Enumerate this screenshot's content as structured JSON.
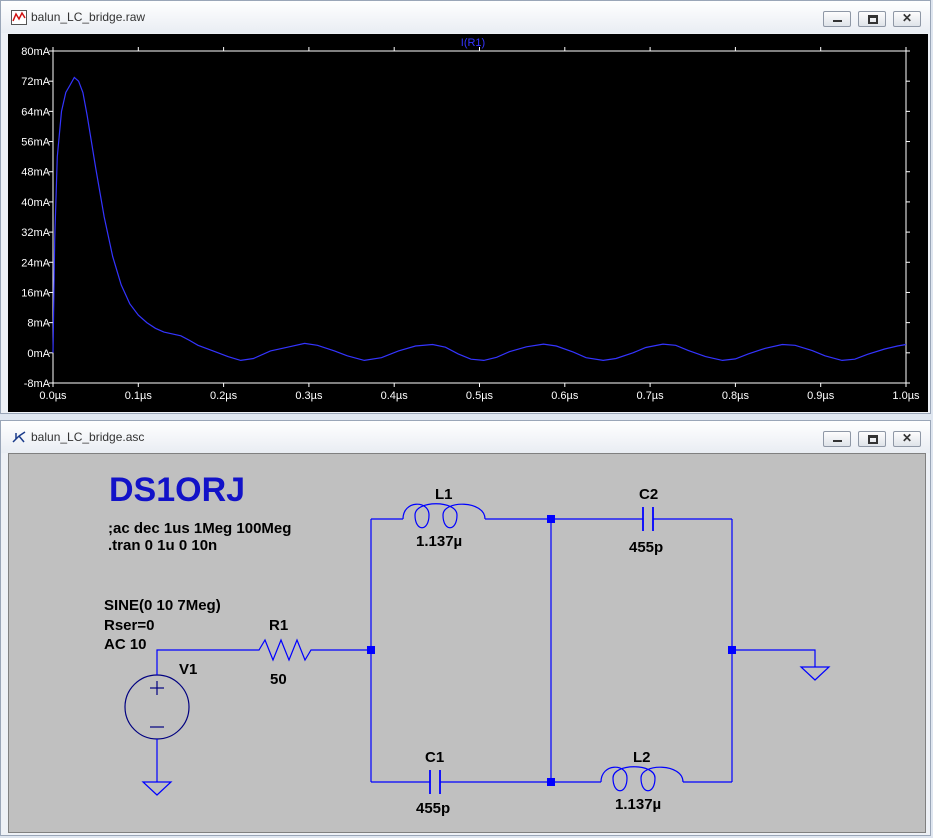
{
  "plot_window": {
    "title": "balun_LC_bridge.raw",
    "trace_label": "I(R1)"
  },
  "schematic_window": {
    "title": "balun_LC_bridge.asc",
    "heading": "DS1ORJ",
    "directive_ac": ";ac dec 1us 1Meg 100Meg",
    "directive_tran": ".tran 0 1u 0 10n",
    "source_params": [
      "SINE(0 10 7Meg)",
      "Rser=0",
      "AC 10"
    ],
    "components": {
      "v1": "V1",
      "r1": {
        "ref": "R1",
        "value": "50"
      },
      "l1": {
        "ref": "L1",
        "value": "1.137µ"
      },
      "c2": {
        "ref": "C2",
        "value": "455p"
      },
      "c1": {
        "ref": "C1",
        "value": "455p"
      },
      "l2": {
        "ref": "L2",
        "value": "1.137µ"
      }
    }
  },
  "window_controls": {
    "minimize": "–",
    "maximize": "□",
    "close": "✕"
  },
  "colors": {
    "trace": "#3434ff",
    "plot_bg": "#000000",
    "schematic_bg": "#c0c0c0",
    "wire": "#0000ff",
    "heading": "#1212c8"
  },
  "chart_data": {
    "type": "line",
    "title": "I(R1)",
    "xlabel": "",
    "ylabel": "",
    "xlim": [
      0,
      1.0
    ],
    "ylim": [
      -8,
      80
    ],
    "x_ticks": [
      "0.0µs",
      "0.1µs",
      "0.2µs",
      "0.3µs",
      "0.4µs",
      "0.5µs",
      "0.6µs",
      "0.7µs",
      "0.8µs",
      "0.9µs",
      "1.0µs"
    ],
    "y_ticks": [
      "80mA",
      "72mA",
      "64mA",
      "56mA",
      "48mA",
      "40mA",
      "32mA",
      "24mA",
      "16mA",
      "8mA",
      "0mA",
      "-8mA"
    ],
    "series": [
      {
        "name": "I(R1)",
        "x_unit": "µs",
        "y_unit": "mA",
        "points": [
          [
            0.0,
            0
          ],
          [
            0.002,
            30
          ],
          [
            0.005,
            52
          ],
          [
            0.01,
            64
          ],
          [
            0.015,
            69
          ],
          [
            0.02,
            71
          ],
          [
            0.025,
            73
          ],
          [
            0.03,
            72
          ],
          [
            0.035,
            69
          ],
          [
            0.04,
            63
          ],
          [
            0.05,
            49
          ],
          [
            0.06,
            36
          ],
          [
            0.07,
            25.5
          ],
          [
            0.08,
            18
          ],
          [
            0.09,
            13
          ],
          [
            0.1,
            10
          ],
          [
            0.11,
            8
          ],
          [
            0.12,
            6.5
          ],
          [
            0.13,
            5.5
          ],
          [
            0.15,
            4.5
          ],
          [
            0.16,
            3.3
          ],
          [
            0.17,
            2
          ],
          [
            0.19,
            0.3
          ],
          [
            0.205,
            -1
          ],
          [
            0.22,
            -2
          ],
          [
            0.235,
            -1.5
          ],
          [
            0.255,
            0.5
          ],
          [
            0.275,
            1.5
          ],
          [
            0.295,
            2.5
          ],
          [
            0.31,
            2
          ],
          [
            0.33,
            0.5
          ],
          [
            0.345,
            -0.8
          ],
          [
            0.365,
            -2
          ],
          [
            0.385,
            -1.3
          ],
          [
            0.405,
            0.5
          ],
          [
            0.425,
            1.8
          ],
          [
            0.445,
            2.2
          ],
          [
            0.46,
            1.5
          ],
          [
            0.475,
            -0.3
          ],
          [
            0.49,
            -1.7
          ],
          [
            0.505,
            -2
          ],
          [
            0.52,
            -1.2
          ],
          [
            0.535,
            0.3
          ],
          [
            0.555,
            1.6
          ],
          [
            0.575,
            2.3
          ],
          [
            0.59,
            1.8
          ],
          [
            0.61,
            0.2
          ],
          [
            0.625,
            -1.3
          ],
          [
            0.645,
            -2
          ],
          [
            0.66,
            -1.5
          ],
          [
            0.68,
            0
          ],
          [
            0.695,
            1.4
          ],
          [
            0.715,
            2.3
          ],
          [
            0.73,
            2
          ],
          [
            0.745,
            0.6
          ],
          [
            0.765,
            -1
          ],
          [
            0.785,
            -2
          ],
          [
            0.8,
            -1.6
          ],
          [
            0.815,
            -0.3
          ],
          [
            0.835,
            1.2
          ],
          [
            0.855,
            2.2
          ],
          [
            0.87,
            2
          ],
          [
            0.89,
            0.6
          ],
          [
            0.905,
            -0.8
          ],
          [
            0.925,
            -2
          ],
          [
            0.94,
            -1.7
          ],
          [
            0.955,
            -0.4
          ],
          [
            0.975,
            1
          ],
          [
            0.99,
            1.8
          ],
          [
            1.0,
            2.2
          ]
        ]
      }
    ],
    "grid": false,
    "legend": "none"
  }
}
